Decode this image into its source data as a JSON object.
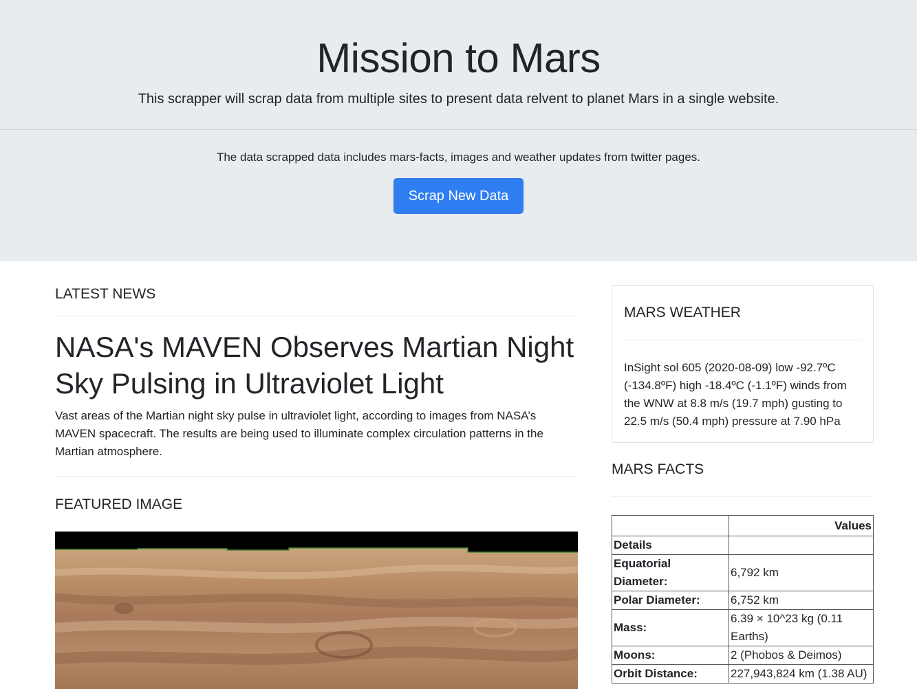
{
  "header": {
    "title": "Mission to Mars",
    "lead": "This scrapper will scrap data from multiple sites to present data relvent to planet Mars in a single website.",
    "description": "The data scrapped data includes mars-facts, images and weather updates from twitter pages.",
    "button_label": "Scrap New Data"
  },
  "news": {
    "heading": "LATEST NEWS",
    "title": "NASA's MAVEN Observes Martian Night Sky Pulsing in Ultraviolet Light",
    "body": "Vast areas of the Martian night sky pulse in ultraviolet light, according to images from NASA’s MAVEN spacecraft. The results are being used to illuminate complex circulation patterns in the Martian atmosphere."
  },
  "featured": {
    "heading": "FEATURED IMAGE"
  },
  "weather": {
    "heading": "MARS WEATHER",
    "text": "InSight sol 605 (2020-08-09) low -92.7ºC (-134.8ºF) high -18.4ºC (-1.1ºF) winds from the WNW at 8.8 m/s (19.7 mph) gusting to 22.5 m/s (50.4 mph) pressure at 7.90 hPa"
  },
  "facts": {
    "heading": "MARS FACTS",
    "column_header": "Values",
    "rows": [
      {
        "label": "Details",
        "value": ""
      },
      {
        "label": "Equatorial Diameter:",
        "value": "6,792 km"
      },
      {
        "label": "Polar Diameter:",
        "value": "6,752 km"
      },
      {
        "label": "Mass:",
        "value": "6.39 × 10^23 kg (0.11 Earths)"
      },
      {
        "label": "Moons:",
        "value": "2 (Phobos & Deimos)"
      },
      {
        "label": "Orbit Distance:",
        "value": "227,943,824 km (1.38 AU)"
      }
    ]
  },
  "colors": {
    "jumbotron_bg": "#e9ecef",
    "button_bg": "#2f7ef2"
  }
}
